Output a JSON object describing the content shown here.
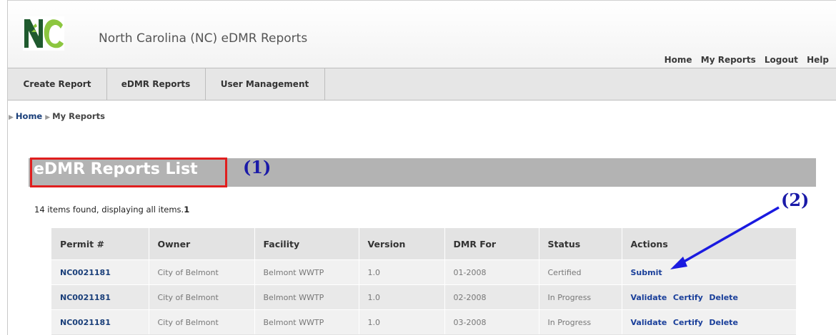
{
  "header": {
    "logo_text": "NC",
    "title": "North Carolina (NC) eDMR Reports",
    "links": [
      "Home",
      "My Reports",
      "Logout",
      "Help"
    ]
  },
  "tabs": [
    "Create Report",
    "eDMR Reports",
    "User Management"
  ],
  "breadcrumb": {
    "home": "Home",
    "current": "My Reports"
  },
  "page_title": "eDMR Reports List",
  "annotations": {
    "one": "(1)",
    "two": "(2)"
  },
  "count": {
    "text": "14 items found, displaying all items.",
    "page": "1"
  },
  "table": {
    "headers": [
      "Permit #",
      "Owner",
      "Facility",
      "Version",
      "DMR For",
      "Status",
      "Actions"
    ],
    "rows": [
      {
        "permit": "NC0021181",
        "owner": "City of Belmont",
        "facility": "Belmont WWTP",
        "version": "1.0",
        "dmr_for": "01-2008",
        "status": "Certified",
        "actions": [
          "Submit"
        ]
      },
      {
        "permit": "NC0021181",
        "owner": "City of Belmont",
        "facility": "Belmont WWTP",
        "version": "1.0",
        "dmr_for": "02-2008",
        "status": "In Progress",
        "actions": [
          "Validate",
          "Certify",
          "Delete"
        ]
      },
      {
        "permit": "NC0021181",
        "owner": "City of Belmont",
        "facility": "Belmont WWTP",
        "version": "1.0",
        "dmr_for": "03-2008",
        "status": "In Progress",
        "actions": [
          "Validate",
          "Certify",
          "Delete"
        ]
      }
    ]
  },
  "colors": {
    "annotation": "#1a1aa8",
    "highlight_box": "#e01e1e",
    "link": "#1a3f7a"
  }
}
